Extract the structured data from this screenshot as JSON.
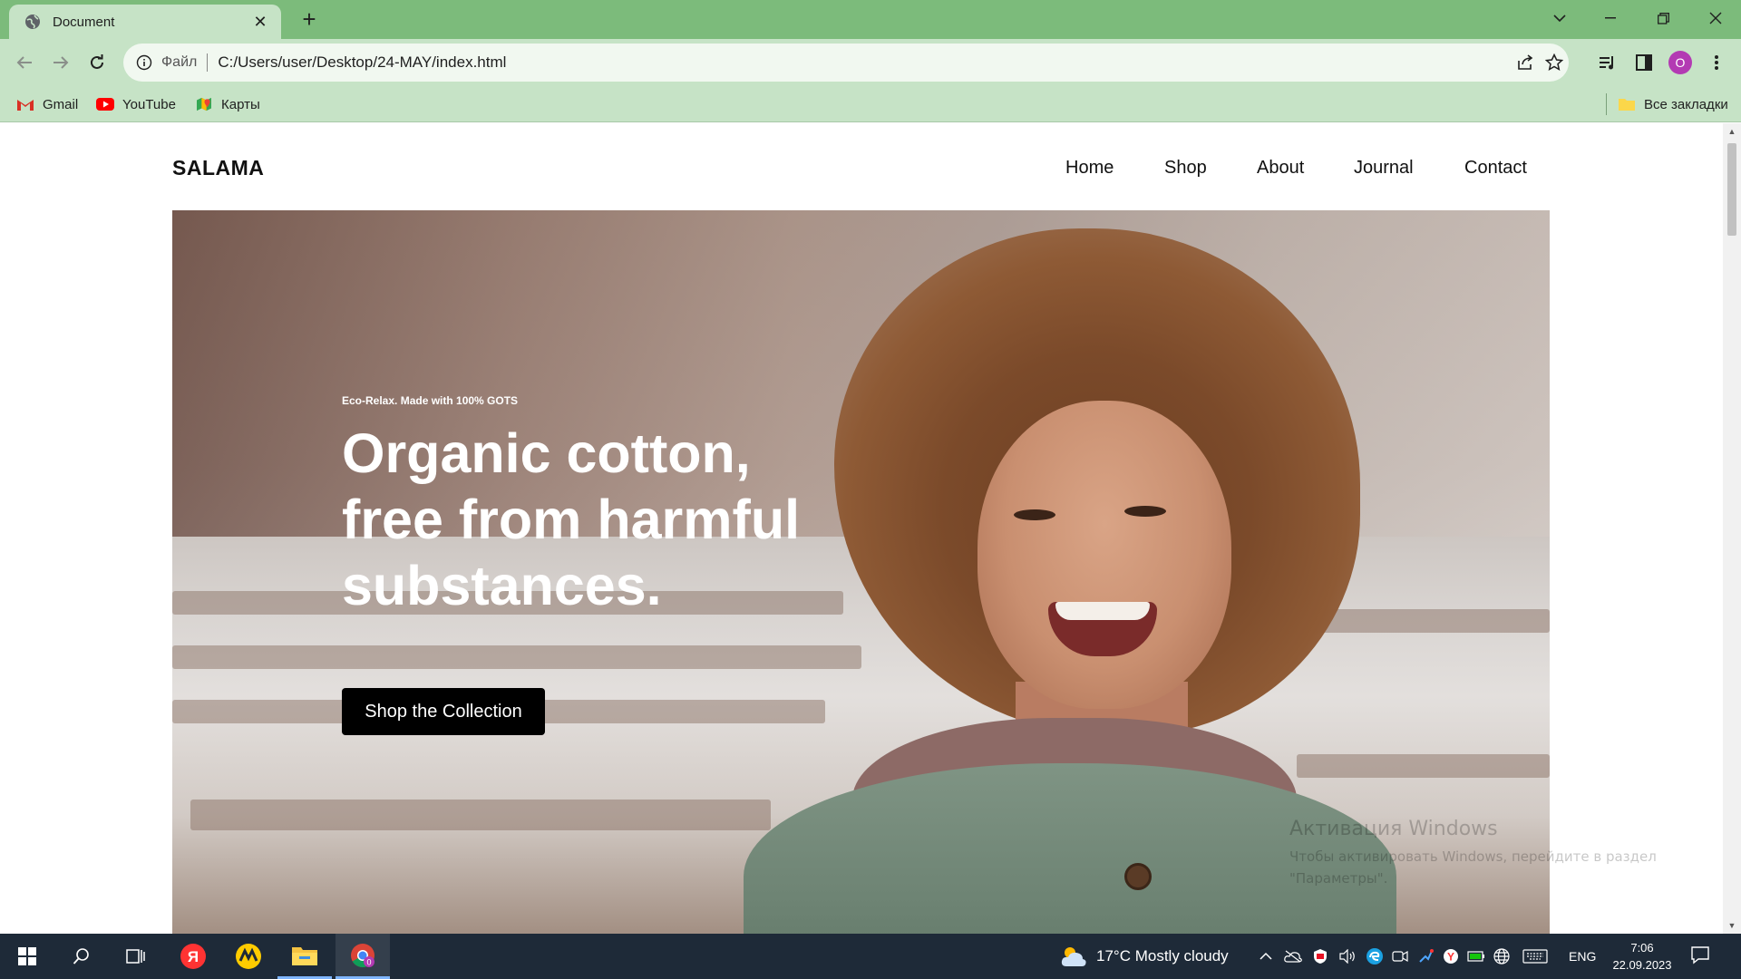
{
  "browser": {
    "tab_title": "Document",
    "new_tab": "+",
    "address_scheme": "Файл",
    "address_url": "C:/Users/user/Desktop/24-MAY/index.html",
    "profile_initial": "O",
    "accent_color": "#7cbb7b",
    "toolbar_color": "#c6e3c6"
  },
  "bookmarks": {
    "items": [
      {
        "label": "Gmail",
        "icon": "gmail-icon"
      },
      {
        "label": "YouTube",
        "icon": "youtube-icon"
      },
      {
        "label": "Карты",
        "icon": "maps-icon"
      }
    ],
    "all_bookmarks": "Все закладки"
  },
  "site": {
    "logo": "SALAMA",
    "nav": [
      "Home",
      "Shop",
      "About",
      "Journal",
      "Contact"
    ],
    "hero": {
      "eyebrow": "Eco-Relax. Made with 100% GOTS",
      "title": "Organic cotton, free from harmful substances.",
      "cta": "Shop the Collection"
    }
  },
  "watermark": {
    "title": "Активация Windows",
    "line1": "Чтобы активировать Windows, перейдите в раздел",
    "line2": "\"Параметры\"."
  },
  "taskbar": {
    "weather": "17°C  Mostly cloudy",
    "language": "ENG",
    "time": "7:06",
    "date": "22.09.2023",
    "chrome_badge": "0"
  }
}
